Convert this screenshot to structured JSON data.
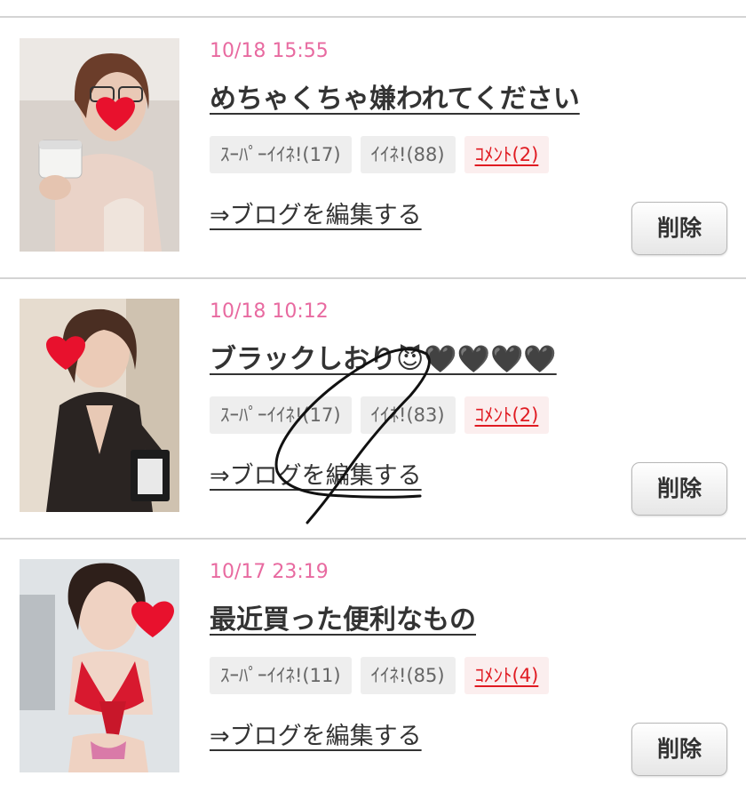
{
  "entries": [
    {
      "date": "10/18 15:55",
      "title": "めちゃくちゃ嫌われてください",
      "super_like": "ｽｰﾊﾟｰｲｲﾈ!(17)",
      "like": "ｲｲﾈ!(88)",
      "comment": "ｺﾒﾝﾄ(2)",
      "edit_link": "⇒ブログを編集する",
      "delete_label": "削除"
    },
    {
      "date": "10/18 10:12",
      "title": "ブラックしおり😈🖤🖤🖤🖤",
      "super_like": "ｽｰﾊﾟｰｲｲﾈ!(17)",
      "like": "ｲｲﾈ!(83)",
      "comment": "ｺﾒﾝﾄ(2)",
      "edit_link": "⇒ブログを編集する",
      "delete_label": "削除"
    },
    {
      "date": "10/17 23:19",
      "title": "最近買った便利なもの",
      "super_like": "ｽｰﾊﾟｰｲｲﾈ!(11)",
      "like": "ｲｲﾈ!(85)",
      "comment": "ｺﾒﾝﾄ(4)",
      "edit_link": "⇒ブログを編集する",
      "delete_label": "削除"
    }
  ],
  "colors": {
    "date": "#e86aa0",
    "comment": "#e01b22",
    "divider": "#d4d4d4",
    "heart": "#e8112d"
  }
}
